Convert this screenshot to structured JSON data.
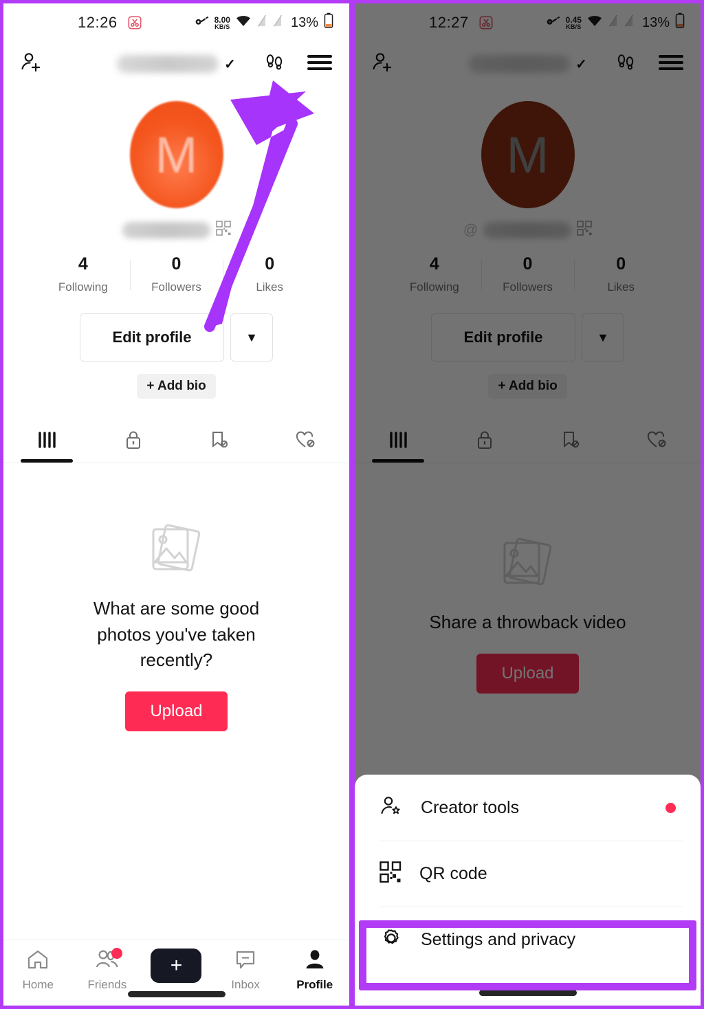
{
  "annotation": {
    "frame_color": "#b23bf5",
    "arrow_color": "#a734fa",
    "arrow_target": "hamburger-menu-button",
    "highlight_target": "Settings and privacy"
  },
  "left_phone": {
    "status_bar": {
      "time": "12:26",
      "scissors_icon": "scissors-icon",
      "key_icon": "key-icon",
      "network_speed": "8.00",
      "network_speed_unit": "KB/S",
      "wifi_icon": "wifi-icon",
      "signal_icon_1": "signal-off-icon",
      "signal_icon_2": "signal-off-icon",
      "battery_percent": "13%",
      "battery_icon": "battery-low-icon"
    },
    "header": {
      "add_person_icon": "add-person-icon",
      "username": "",
      "username_blurred": true,
      "chevron": "✓",
      "footsteps_icon": "footsteps-icon",
      "menu_icon": "hamburger-menu-icon"
    },
    "profile": {
      "avatar_letter": "M",
      "avatar_color": "#f4561e",
      "handle": "",
      "handle_blurred": true,
      "qr_icon": "qr-code-icon",
      "stats": [
        {
          "value": "4",
          "label": "Following"
        },
        {
          "value": "0",
          "label": "Followers"
        },
        {
          "value": "0",
          "label": "Likes"
        }
      ],
      "edit_profile_label": "Edit profile",
      "caret_label": "▼",
      "add_bio_label": "+ Add bio"
    },
    "tabs": [
      {
        "name": "videos-tab",
        "icon": "grid-bars-icon",
        "active": true
      },
      {
        "name": "private-tab",
        "icon": "lock-icon",
        "active": false
      },
      {
        "name": "saved-tab",
        "icon": "bookmark-hidden-icon",
        "active": false
      },
      {
        "name": "liked-tab",
        "icon": "heart-hidden-icon",
        "active": false
      }
    ],
    "empty_state": {
      "image_icon": "photos-icon",
      "prompt": "What are some good photos you've taken recently?",
      "upload_label": "Upload",
      "upload_color": "#fe2c55"
    },
    "bottom_nav": [
      {
        "label": "Home",
        "icon": "home-icon",
        "active": false,
        "badge": false
      },
      {
        "label": "Friends",
        "icon": "friends-icon",
        "active": false,
        "badge": true
      },
      {
        "label": "",
        "icon": "create-plus-icon",
        "active": false,
        "badge": false
      },
      {
        "label": "Inbox",
        "icon": "inbox-icon",
        "active": false,
        "badge": false
      },
      {
        "label": "Profile",
        "icon": "profile-icon",
        "active": true,
        "badge": false
      }
    ]
  },
  "right_phone": {
    "status_bar": {
      "time": "12:27",
      "scissors_icon": "scissors-icon",
      "key_icon": "key-icon",
      "network_speed": "0.45",
      "network_speed_unit": "KB/S",
      "wifi_icon": "wifi-icon",
      "signal_icon_1": "signal-off-icon",
      "signal_icon_2": "signal-off-icon",
      "battery_percent": "13%",
      "battery_icon": "battery-low-icon"
    },
    "header": {
      "add_person_icon": "add-person-icon",
      "username": "",
      "username_blurred": true,
      "chevron": "✓",
      "footsteps_icon": "footsteps-icon",
      "menu_icon": "hamburger-menu-icon"
    },
    "profile": {
      "avatar_letter": "M",
      "avatar_color": "#8c2f15",
      "handle_prefix": "@",
      "handle": "",
      "handle_blurred": true,
      "qr_icon": "qr-code-icon",
      "stats": [
        {
          "value": "4",
          "label": "Following"
        },
        {
          "value": "0",
          "label": "Followers"
        },
        {
          "value": "0",
          "label": "Likes"
        }
      ],
      "edit_profile_label": "Edit profile",
      "caret_label": "▼",
      "add_bio_label": "+ Add bio"
    },
    "tabs": [
      {
        "name": "videos-tab",
        "icon": "grid-bars-icon",
        "active": true
      },
      {
        "name": "private-tab",
        "icon": "lock-icon",
        "active": false
      },
      {
        "name": "saved-tab",
        "icon": "bookmark-hidden-icon",
        "active": false
      },
      {
        "name": "liked-tab",
        "icon": "heart-hidden-icon",
        "active": false
      }
    ],
    "empty_state": {
      "image_icon": "photos-icon",
      "prompt": "Share a throwback video",
      "upload_label": "Upload",
      "upload_color": "#fe2c55"
    },
    "sheet": {
      "items": [
        {
          "label": "Creator tools",
          "icon": "person-star-icon",
          "badge": true
        },
        {
          "label": "QR code",
          "icon": "qr-code-icon",
          "badge": false
        },
        {
          "label": "Settings and privacy",
          "icon": "gear-icon",
          "badge": false
        }
      ]
    }
  }
}
